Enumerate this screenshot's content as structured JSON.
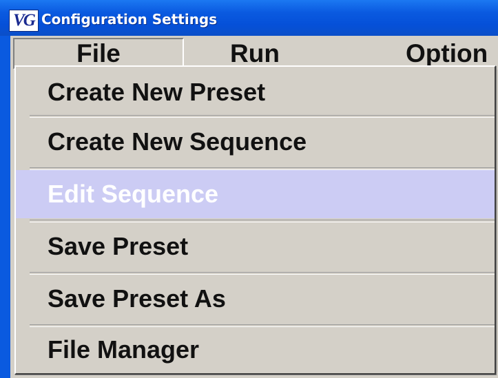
{
  "window": {
    "title": "Configuration Settings",
    "icon_text": "VG"
  },
  "menubar": {
    "file": "File",
    "run": "Run",
    "options": "Option"
  },
  "file_menu": {
    "items": [
      {
        "label": "Create New Preset",
        "enabled": true
      },
      {
        "label": "Create New Sequence",
        "enabled": true
      },
      {
        "label": "Edit Sequence",
        "enabled": true,
        "highlighted": true
      },
      {
        "label": "Save Preset",
        "enabled": true
      },
      {
        "label": "Save Preset As",
        "enabled": true
      },
      {
        "label": "File Manager",
        "enabled": true
      }
    ]
  },
  "colors": {
    "titlebar": "#0a5ae0",
    "menu_bg": "#d4d0c8",
    "highlight_bg": "#ccccf4",
    "highlight_text": "#ffffff"
  }
}
